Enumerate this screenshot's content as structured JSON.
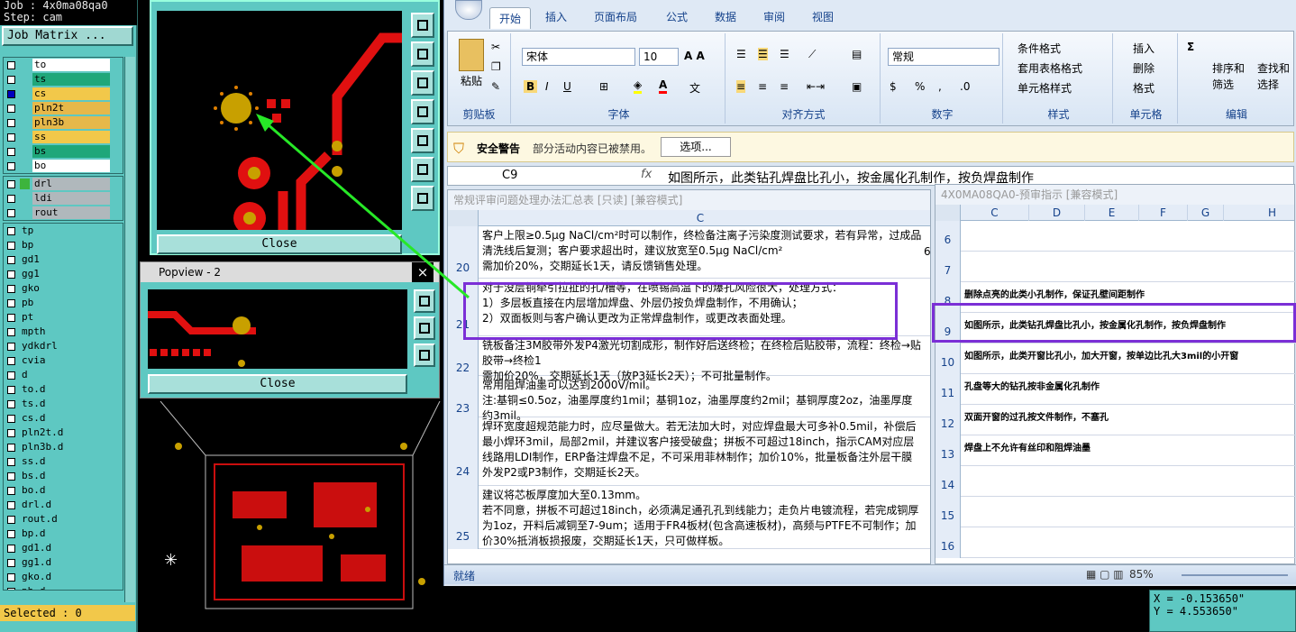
{
  "cam": {
    "job_title": "Job : 4x0ma08qa0",
    "step": "Step: cam",
    "job_matrix_label": "Job Matrix ...",
    "layers_group1": [
      {
        "name": "to",
        "color": "#ffffff",
        "selected": false
      },
      {
        "name": "ts",
        "color": "#1fa77a",
        "selected": false
      },
      {
        "name": "cs",
        "color": "#f2c84a",
        "selected": true
      },
      {
        "name": "pln2t",
        "color": "#e6b84a",
        "selected": false
      },
      {
        "name": "pln3b",
        "color": "#e6b84a",
        "selected": false
      },
      {
        "name": "ss",
        "color": "#f2c84a",
        "selected": false
      },
      {
        "name": "bs",
        "color": "#1fa77a",
        "selected": false
      },
      {
        "name": "bo",
        "color": "#ffffff",
        "selected": false
      }
    ],
    "layers_group2": [
      {
        "name": "drl",
        "color": "#b0b8bc",
        "swatch": "#3db43d"
      },
      {
        "name": "ldi",
        "color": "#b0b8bc",
        "swatch": ""
      },
      {
        "name": "rout",
        "color": "#b0b8bc",
        "swatch": ""
      }
    ],
    "layers_group3": [
      "tp",
      "bp",
      "gd1",
      "gg1",
      "gko",
      "pb",
      "pt",
      "mpth",
      "ydkdrl",
      "cvia",
      "d",
      "to.d",
      "ts.d",
      "cs.d",
      "pln2t.d",
      "pln3b.d",
      "ss.d",
      "bs.d",
      "bo.d",
      "drl.d",
      "rout.d",
      "bp.d",
      "gd1.d",
      "gg1.d",
      "gko.d",
      "pb.d"
    ],
    "selected_label": "Selected : 0",
    "close_label": "Close",
    "popview_title": "Popview - 2",
    "popview_close": "×",
    "coord_x": "X = -0.153650\"",
    "coord_y": "Y = 4.553650\""
  },
  "excel": {
    "tabs": [
      "开始",
      "插入",
      "页面布局",
      "公式",
      "数据",
      "审阅",
      "视图"
    ],
    "groups": {
      "clipboard": "剪贴板",
      "font": "字体",
      "align": "对齐方式",
      "number": "数字",
      "styles": "样式",
      "cells": "单元格",
      "edit": "编辑"
    },
    "paste": "粘贴",
    "font_name": "宋体",
    "font_size": "10",
    "number_format": "常规",
    "cond_format": "条件格式",
    "table_format": "套用表格格式",
    "cell_styles": "单元格样式",
    "insert": "插入",
    "delete": "删除",
    "format": "格式",
    "sort": "排序和",
    "filter": "筛选",
    "find": "查找和",
    "select": "选择",
    "security_label": "安全警告",
    "security_msg": "部分活动内容已被禁用。",
    "options_btn": "选项...",
    "name_box": "C9",
    "fx": "fx",
    "formula": "如图所示，此类钻孔焊盘比孔小，按金属化孔制作，按负焊盘制作",
    "left_title": "常规评审问题处理办法汇总表  [只读]  [兼容模式]",
    "left_col": "C",
    "left_rows": [
      {
        "num": "20",
        "text": "客户上限≥0.5μg NaCl/cm²时可以制作，终检备注离子污染度测试要求，若有异常，过成品清洗线后复测；客户要求超出时，建议放宽至0.5μg NaCl/cm²\n需加价20%，交期延长1天，请反馈销售处理。",
        "extra": "6"
      },
      {
        "num": "21",
        "text": "对于没层铜牵引拉扯的孔/槽等，在喷锡高温下的爆孔风险很大，处理方式：\n1）多层板直接在内层增加焊盘、外层仍按负焊盘制作，不用确认；\n2）双面板则与客户确认更改为正常焊盘制作，或更改表面处理。",
        "extra": ""
      },
      {
        "num": "22",
        "text": "铣板备注3M胶带外发P4激光切割成形，制作好后送终检；在终检后贴胶带，流程：终检→贴胶带→终检1\n需加价20%，交期延长1天（放P3延长2天）；不可批量制作。",
        "extra": ""
      },
      {
        "num": "23",
        "text": "常用阻焊油墨可以达到2000V/mil。\n注:基铜≤0.5oz，油墨厚度约1mil；基铜1oz，油墨厚度约2mil；基铜厚度2oz，油墨厚度约3mil。",
        "extra": ""
      },
      {
        "num": "24",
        "text": "焊环宽度超规范能力时，应尽量做大。若无法加大时，对应焊盘最大可多补0.5mil，补偿后最小焊环3mil，局部2mil，并建议客户接受破盘；拼板不可超过18inch，指示CAM对应层线路用LDI制作，ERP备注焊盘不足，不可采用菲林制作；加价10%，批量板备注外层干膜外发P2或P3制作，交期延长2天。",
        "extra": ""
      },
      {
        "num": "25",
        "text": "建议将芯板厚度加大至0.13mm。\n若不同意，拼板不可超过18inch，必须满足通孔孔到线能力；走负片电镀流程，若完成铜厚为1oz，开料后减铜至7-9um；适用于FR4板材(包含高速板材)，高频与PTFE不可制作；加价30%抵消板损报废，交期延长1天，只可做样板。",
        "extra": ""
      }
    ],
    "right_title": "4X0MA08QA0-预审指示  [兼容模式]",
    "right_cols": [
      "C",
      "D",
      "E",
      "F",
      "G",
      "H"
    ],
    "right_rows": [
      {
        "num": "6",
        "text": ""
      },
      {
        "num": "7",
        "text": ""
      },
      {
        "num": "8",
        "text": "删除点亮的此类小孔制作，保证孔壁间距制作"
      },
      {
        "num": "9",
        "text": "如图所示，此类钻孔焊盘比孔小，按金属化孔制作，按负焊盘制作"
      },
      {
        "num": "10",
        "text": "如图所示，此类开窗比孔小，加大开窗，按单边比孔大3mil的小开窗"
      },
      {
        "num": "11",
        "text": "孔盘等大的钻孔按非金属化孔制作"
      },
      {
        "num": "12",
        "text": "双面开窗的过孔按文件制作，不塞孔"
      },
      {
        "num": "13",
        "text": "焊盘上不允许有丝印和阻焊油墨"
      },
      {
        "num": "14",
        "text": ""
      },
      {
        "num": "15",
        "text": ""
      },
      {
        "num": "16",
        "text": ""
      }
    ],
    "status_ready": "就绪",
    "zoom": "85%"
  },
  "colors": {
    "annotation_green": "#27e827",
    "highlight_purple": "#7b2fd6",
    "pcb_red": "#e01010",
    "pad_gold": "#c8a000"
  }
}
